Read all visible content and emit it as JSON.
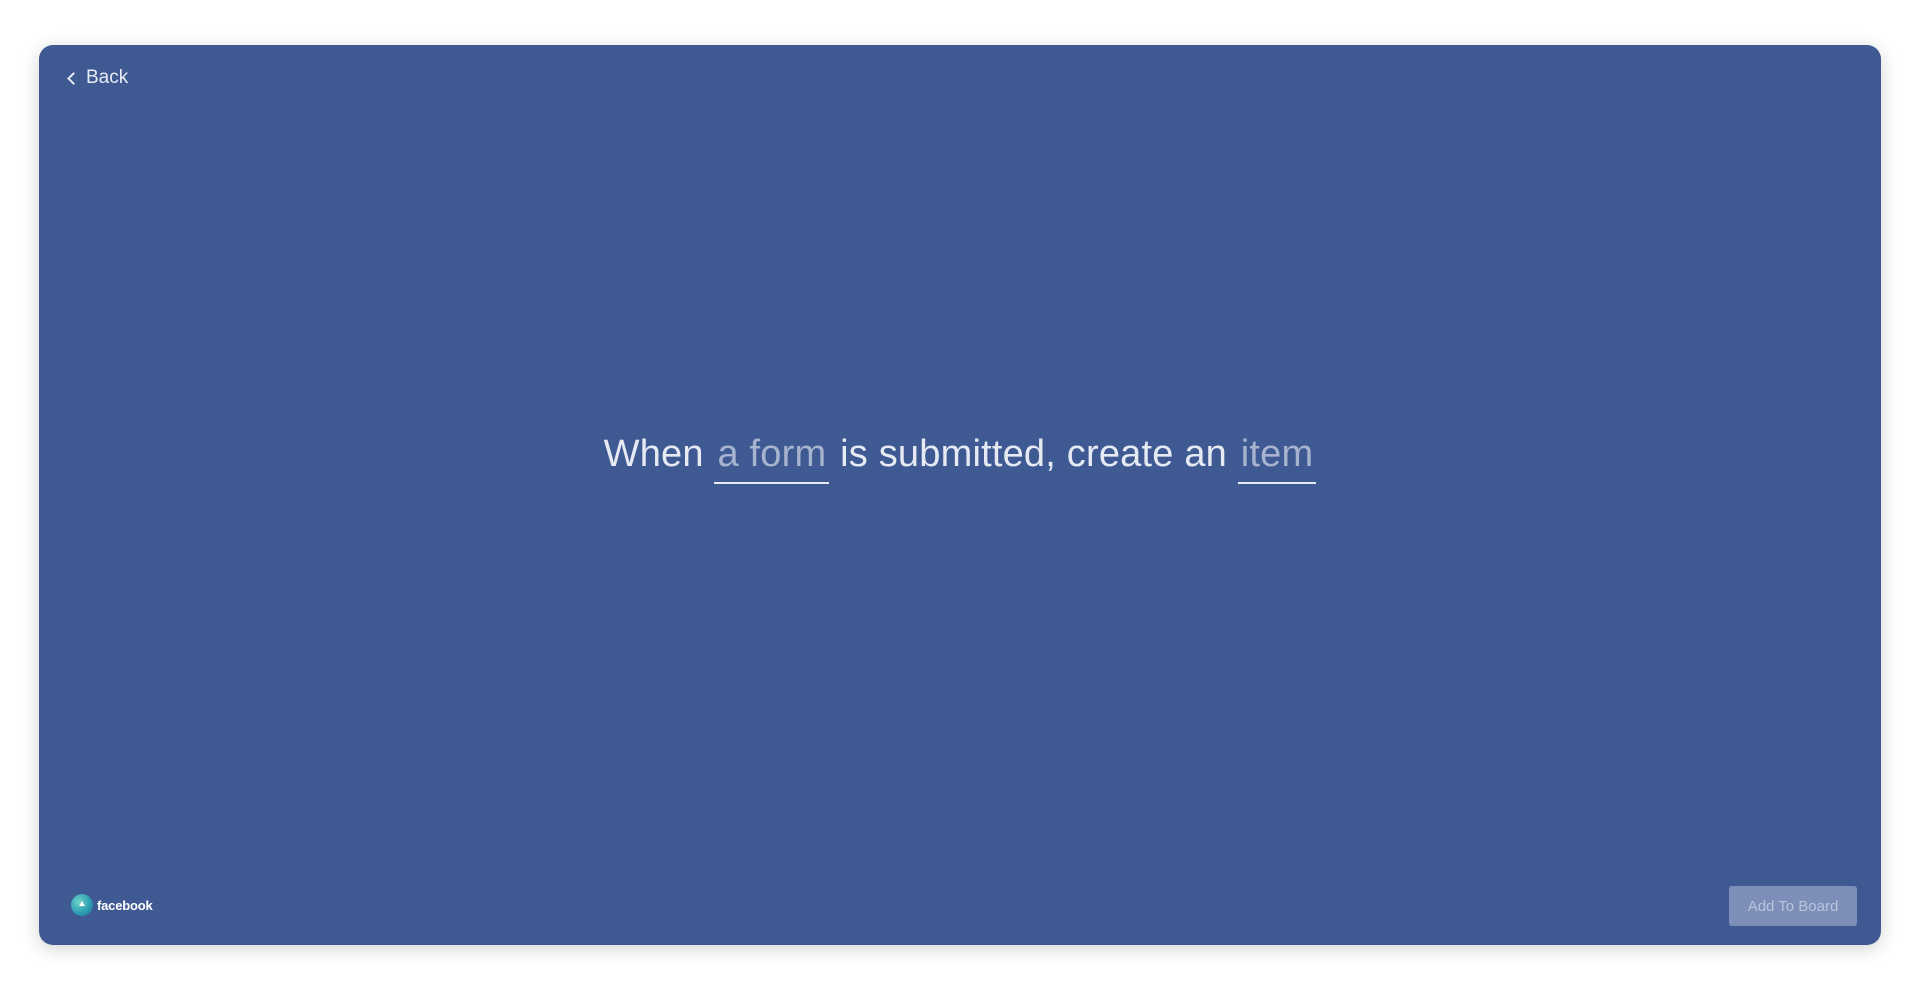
{
  "header": {
    "back_label": "Back"
  },
  "recipe": {
    "part1": "When ",
    "slot_trigger": "a form",
    "part2": " is submitted, create an ",
    "slot_action": "item"
  },
  "footer": {
    "logo_text": "facebook",
    "add_button_label": "Add To Board"
  },
  "colors": {
    "modal_background": "#3f5a92",
    "slot_text": "#a7b3cf",
    "button_background": "#7d8fb8"
  },
  "icons": {
    "back": "chevron-left-icon",
    "logo": "facebook-ads-logo-icon"
  }
}
